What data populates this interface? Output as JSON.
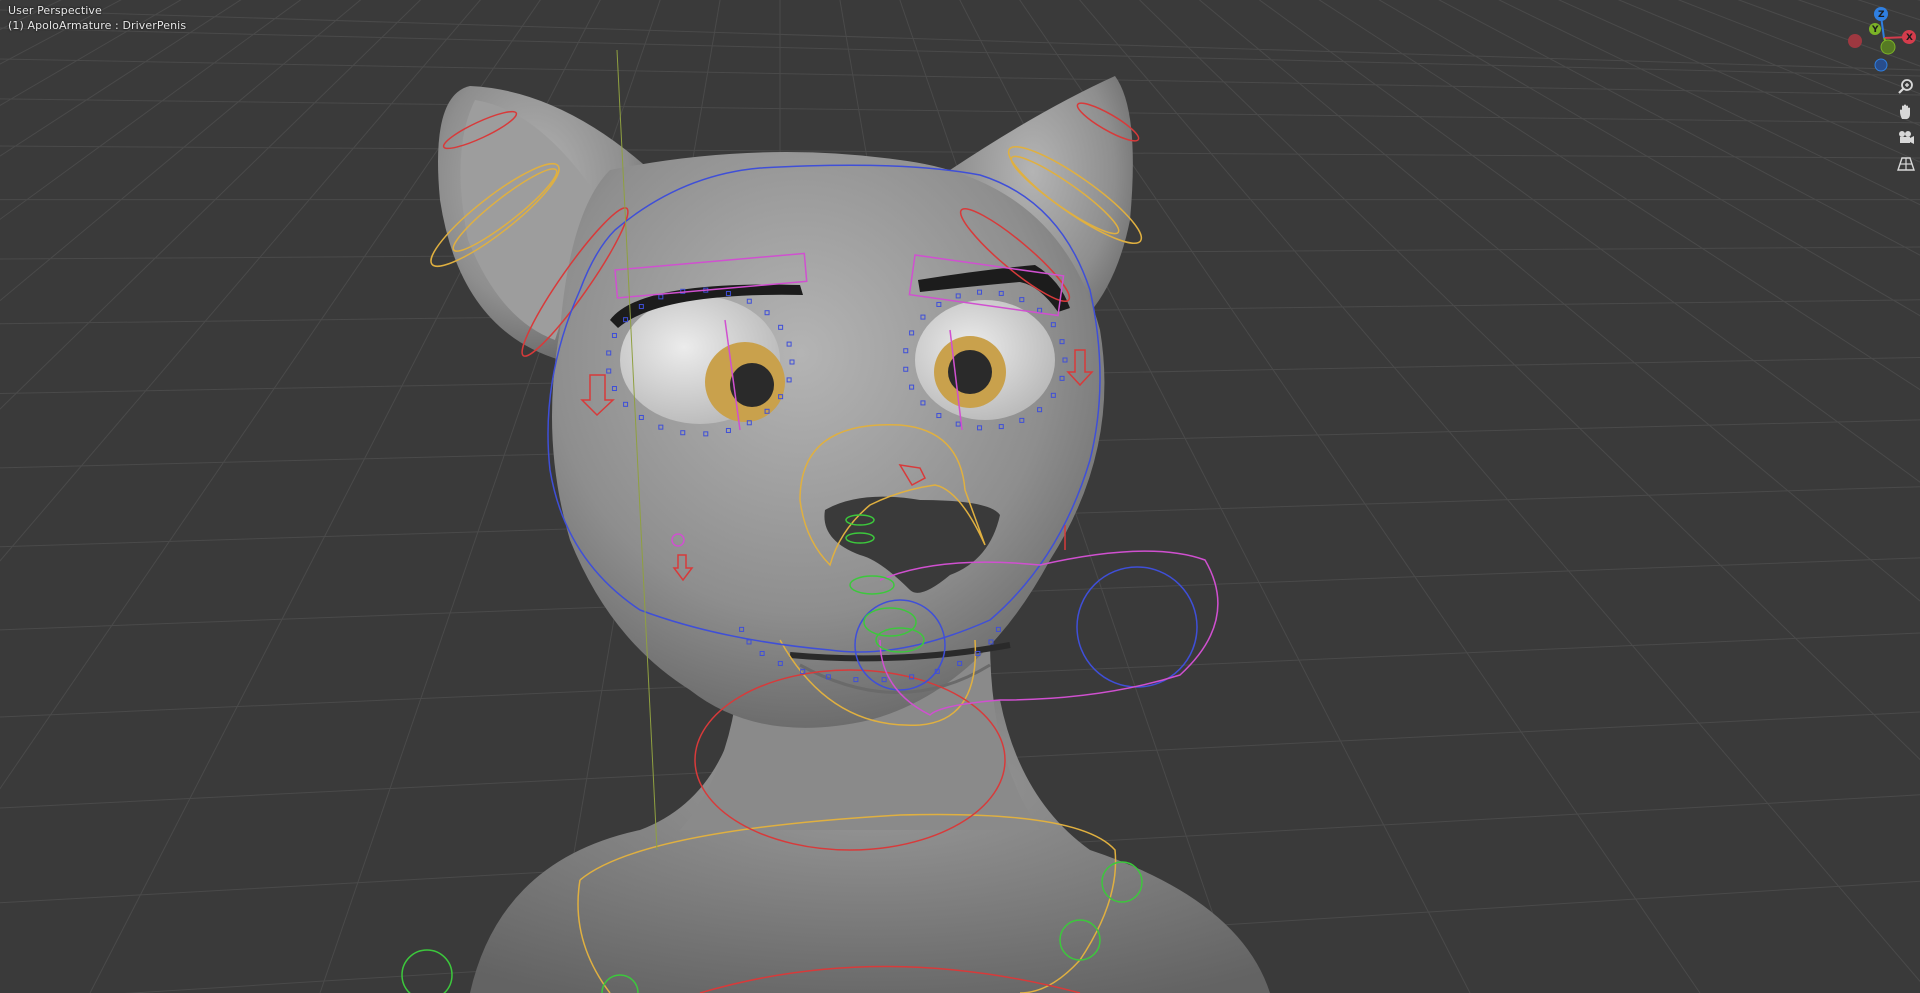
{
  "viewport": {
    "view_name": "User Perspective",
    "object_info": "(1) ApoloArmature : DriverPenis"
  },
  "gizmo": {
    "axes": [
      {
        "label": "Z",
        "color": "#2f7fe0"
      },
      {
        "label": "Y",
        "color": "#7bb327"
      },
      {
        "label": "X",
        "color": "#d43c4c"
      }
    ]
  },
  "nav_buttons": [
    {
      "name": "zoom-icon"
    },
    {
      "name": "pan-hand-icon"
    },
    {
      "name": "camera-icon"
    },
    {
      "name": "perspective-grid-icon"
    }
  ],
  "colors": {
    "background": "#3a3a3a",
    "grid_line": "#4a4a4a",
    "mesh": "#8c8c8c",
    "bone_yellow": "#e0b040",
    "bone_red": "#d83a3a",
    "bone_blue": "#3f4fd8",
    "bone_pink": "#d050d0",
    "bone_green": "#3cc83c"
  }
}
